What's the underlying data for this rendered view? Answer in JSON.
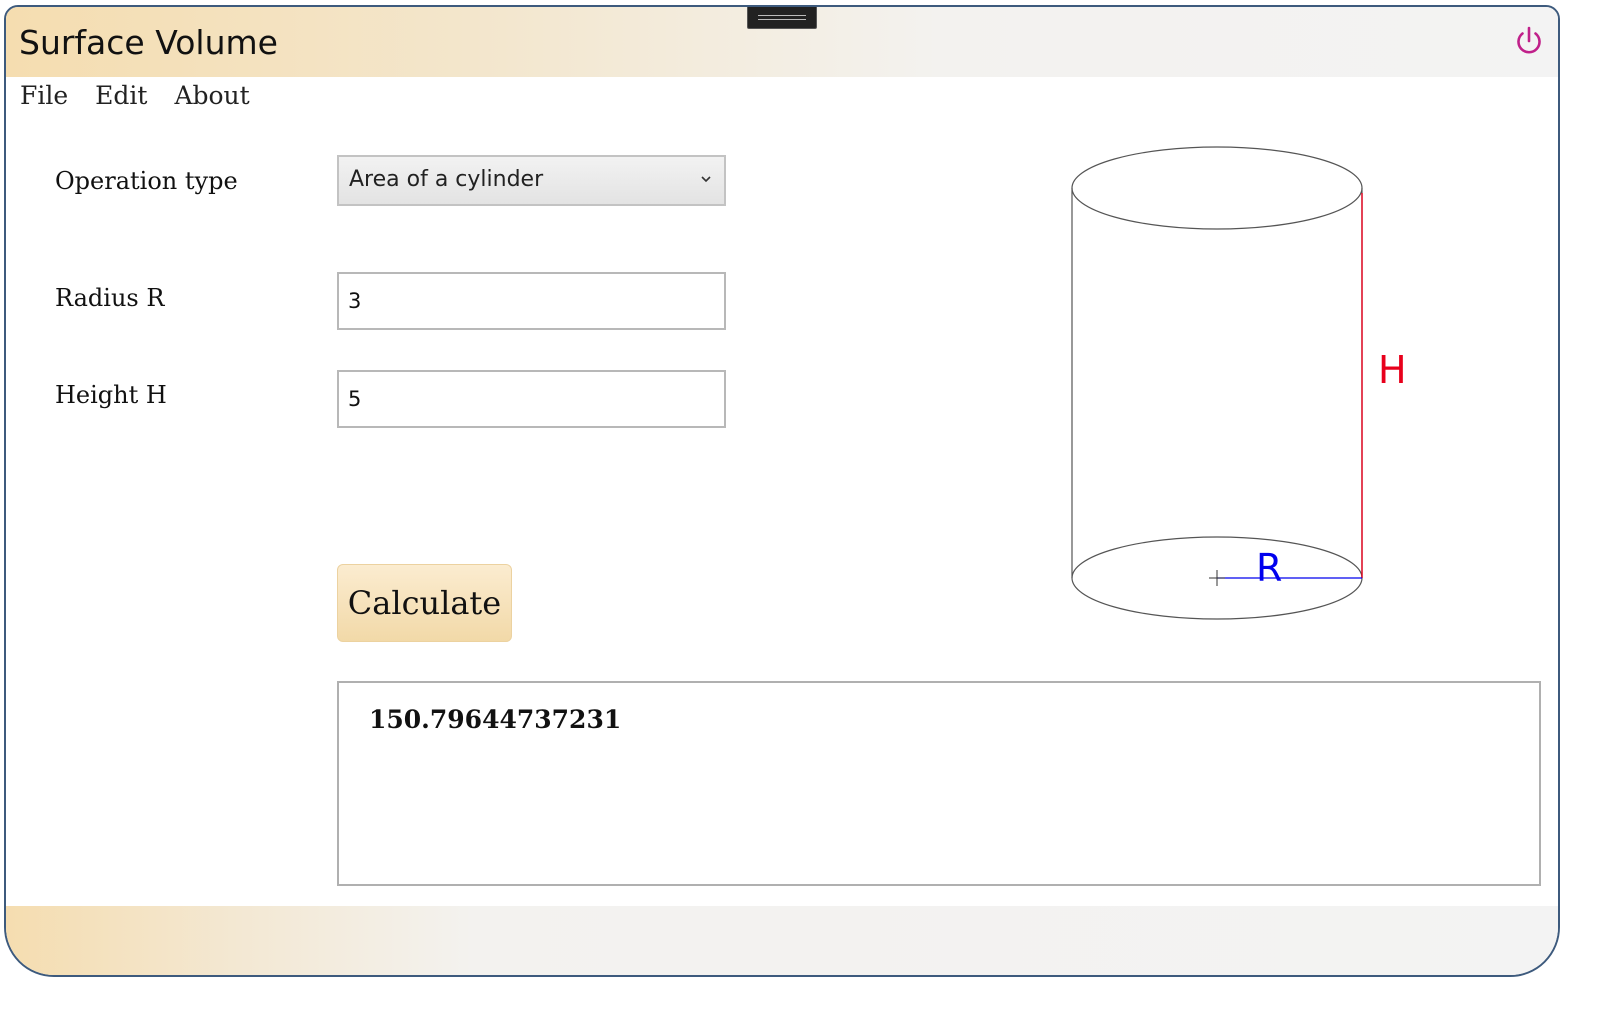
{
  "app": {
    "title": "Surface Volume"
  },
  "menu": {
    "items": [
      "File",
      "Edit",
      "About"
    ]
  },
  "form": {
    "operation_label": "Operation type",
    "operation_value": "Area of a cylinder",
    "radius_label": "Radius R",
    "radius_value": "3",
    "height_label": "Height H",
    "height_value": "5",
    "calculate_label": "Calculate"
  },
  "result": {
    "value": "150.79644737231"
  },
  "diagram": {
    "height_symbol": "H",
    "radius_symbol": "R"
  },
  "colors": {
    "power_icon": "#c0208a",
    "height_line": "#e8001c",
    "radius_line": "#0000ee",
    "window_border": "#3d5a7d",
    "accent": "#f5ddb0"
  },
  "icons": {
    "power": "power-icon",
    "dropdown": "chevron-down-icon",
    "grip": "grip-handle-icon"
  }
}
